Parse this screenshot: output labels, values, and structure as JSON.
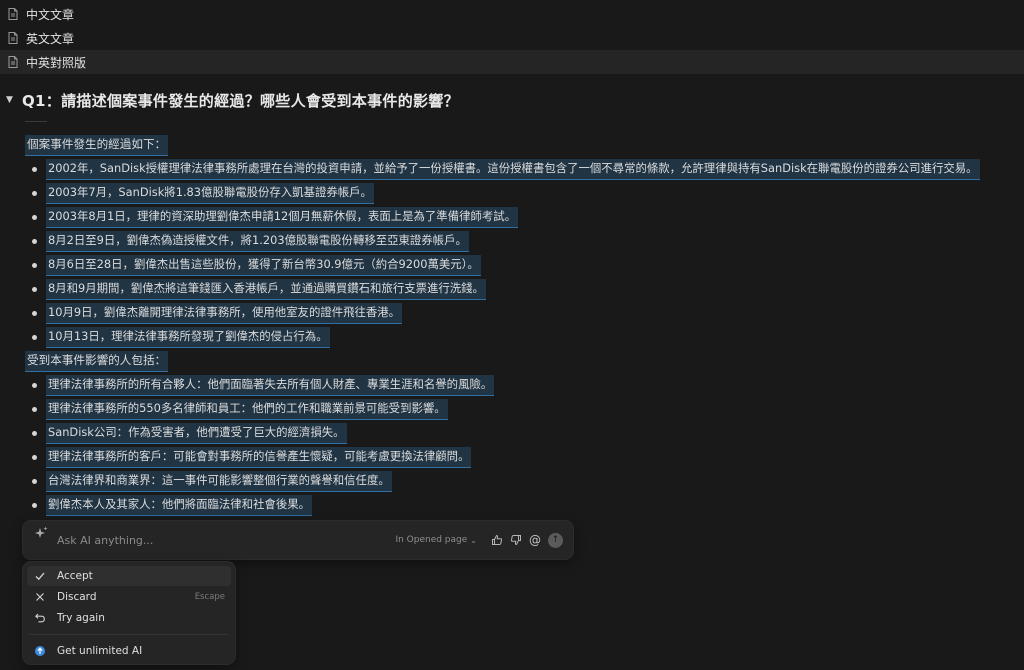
{
  "pages": [
    {
      "label": "中文文章",
      "icon": "document-icon"
    },
    {
      "label": "英文文章",
      "icon": "document-icon"
    },
    {
      "label": "中英對照版",
      "icon": "document-icon"
    }
  ],
  "toggle": {
    "arrow": "▼",
    "heading": "Q1：請描述個案事件發生的經過？哪些人會受到本事件的影響？"
  },
  "section1": {
    "intro": "個案事件發生的經過如下：",
    "items": [
      "2002年，SanDisk授權理律法律事務所處理在台灣的投資申請，並給予了一份授權書。這份授權書包含了一個不尋常的條款，允許理律與持有SanDisk在聯電股份的證券公司進行交易。",
      "2003年7月，SanDisk將1.83億股聯電股份存入凱基證券帳戶。",
      "2003年8月1日，理律的資深助理劉偉杰申請12個月無薪休假，表面上是為了準備律師考試。",
      "8月2日至9日，劉偉杰偽造授權文件，將1.203億股聯電股份轉移至亞東證券帳戶。",
      "8月6日至28日，劉偉杰出售這些股份，獲得了新台幣30.9億元（約合9200萬美元）。",
      "8月和9月期間，劉偉杰將這筆錢匯入香港帳戶，並通過購買鑽石和旅行支票進行洗錢。",
      "10月9日，劉偉杰離開理律法律事務所，使用他室友的證件飛往香港。",
      "10月13日，理律法律事務所發現了劉偉杰的侵占行為。"
    ]
  },
  "section2": {
    "intro": "受到本事件影響的人包括：",
    "items": [
      "理律法律事務所的所有合夥人：他們面臨著失去所有個人財產、專業生涯和名譽的風險。",
      "理律法律事務所的550多名律師和員工：他們的工作和職業前景可能受到影響。",
      "SanDisk公司：作為受害者，他們遭受了巨大的經濟損失。",
      "理律法律事務所的客戶：可能會對事務所的信譽產生懷疑，可能考慮更換法律顧問。",
      "台灣法律界和商業界：這一事件可能影響整個行業的聲譽和信任度。",
      "劉偉杰本人及其家人：他們將面臨法律和社會後果。"
    ]
  },
  "ai_bar": {
    "placeholder": "Ask AI anything...",
    "scope": "In Opened page",
    "icons": [
      "sparkle-icon",
      "thumbs-up-icon",
      "thumbs-down-icon",
      "mention-icon",
      "send-icon"
    ]
  },
  "menu": {
    "items": [
      {
        "label": "Accept",
        "icon": "check-icon",
        "shortcut": ""
      },
      {
        "label": "Discard",
        "icon": "close-icon",
        "shortcut": "Escape"
      },
      {
        "label": "Try again",
        "icon": "undo-icon",
        "shortcut": ""
      }
    ],
    "footer": {
      "label": "Get unlimited AI",
      "icon": "upgrade-icon"
    }
  }
}
